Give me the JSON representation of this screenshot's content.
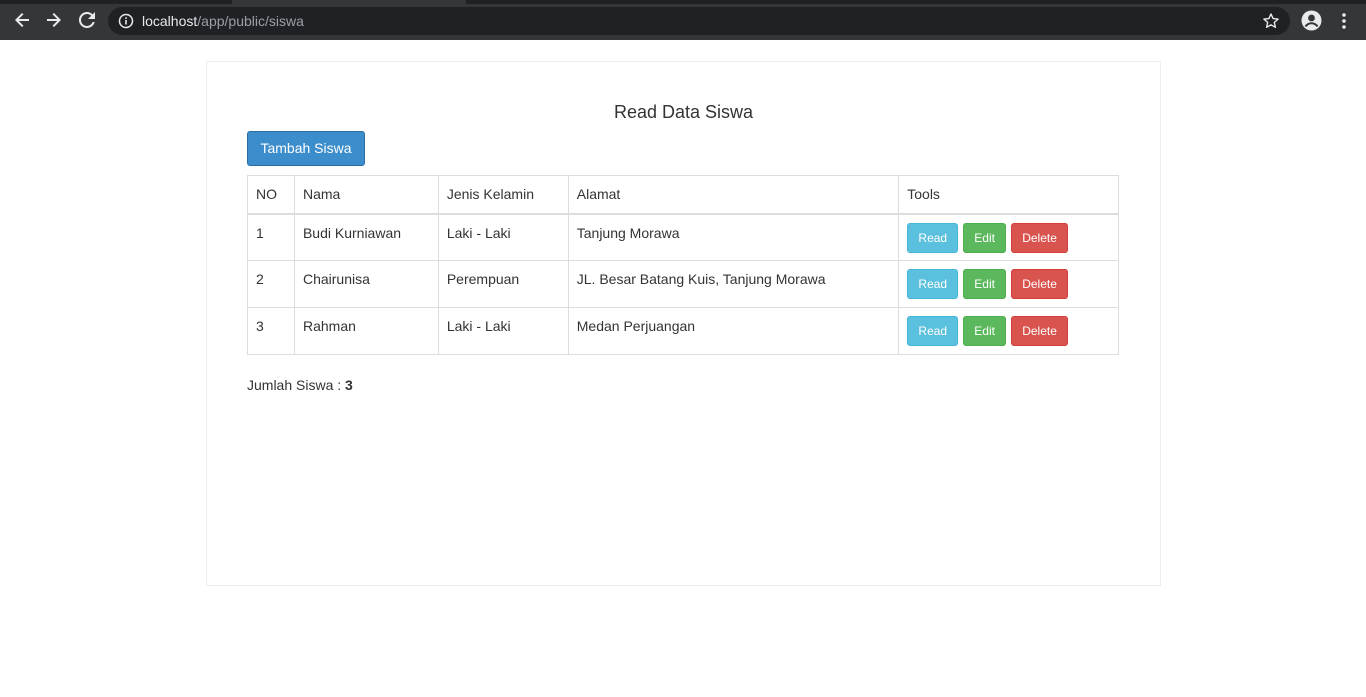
{
  "browser": {
    "url_host": "localhost",
    "url_path": "/app/public/siswa"
  },
  "page": {
    "title": "Read Data Siswa",
    "add_button": "Tambah Siswa",
    "table": {
      "headers": [
        "NO",
        "Nama",
        "Jenis Kelamin",
        "Alamat",
        "Tools"
      ],
      "rows": [
        {
          "no": "1",
          "nama": "Budi Kurniawan",
          "jk": "Laki - Laki",
          "alamat": "Tanjung Morawa"
        },
        {
          "no": "2",
          "nama": "Chairunisa",
          "jk": "Perempuan",
          "alamat": "JL. Besar Batang Kuis, Tanjung Morawa"
        },
        {
          "no": "3",
          "nama": "Rahman",
          "jk": "Laki - Laki",
          "alamat": "Medan Perjuangan"
        }
      ],
      "actions": {
        "read": "Read",
        "edit": "Edit",
        "delete": "Delete"
      }
    },
    "summary_label": "Jumlah Siswa : ",
    "summary_count": "3"
  }
}
